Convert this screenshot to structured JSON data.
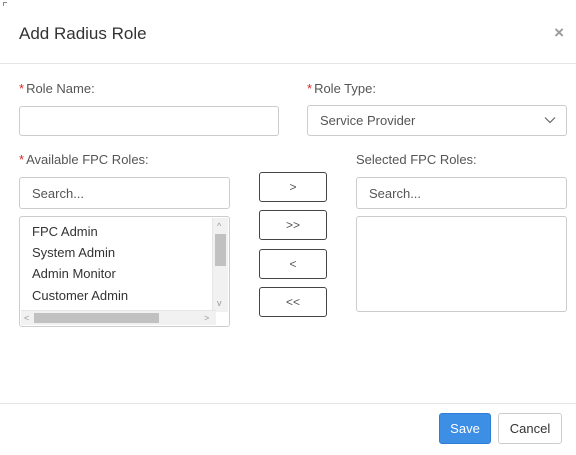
{
  "dialog": {
    "title": "Add Radius Role",
    "close_glyph": "×"
  },
  "form": {
    "required_marker": "*",
    "role_name_label": "Role Name:",
    "role_name_value": "",
    "role_type_label": "Role Type:",
    "role_type_value": "Service Provider",
    "available_label": "Available FPC Roles:",
    "available_search_placeholder": "Search...",
    "available_items": [
      "FPC Admin",
      "System Admin",
      "Admin Monitor",
      "Customer Admin"
    ],
    "selected_label": "Selected FPC Roles:",
    "selected_search_placeholder": "Search...",
    "selected_items": []
  },
  "transfer": {
    "move_right": ">",
    "move_all_right": ">>",
    "move_left": "<",
    "move_all_left": "<<"
  },
  "scroll": {
    "up": "^",
    "down": "v",
    "left": "<",
    "right": ">"
  },
  "footer": {
    "save_label": "Save",
    "cancel_label": "Cancel"
  },
  "colors": {
    "primary": "#3d8fe6",
    "required": "#e02424"
  }
}
